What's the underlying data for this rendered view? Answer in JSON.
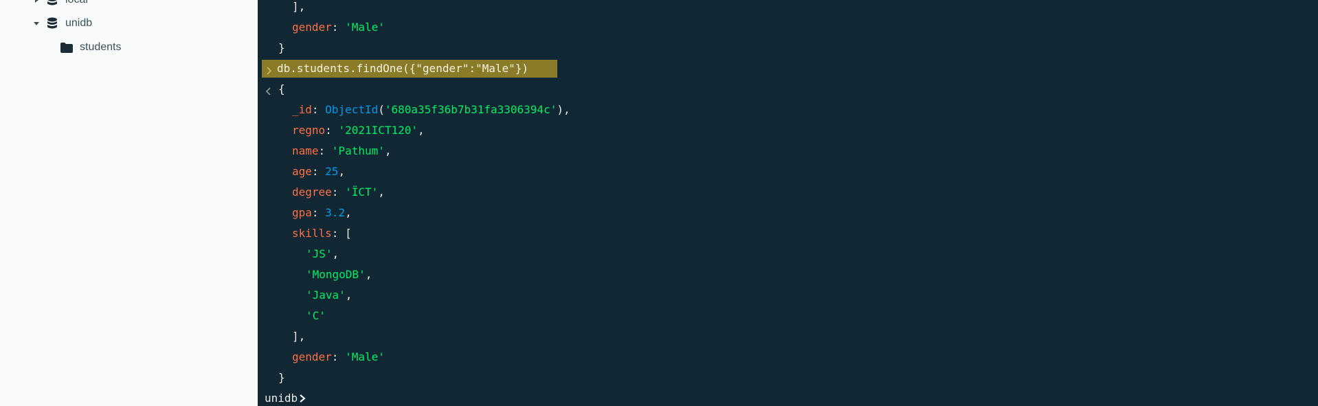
{
  "sidebar": {
    "databases": [
      {
        "label": "local",
        "expanded": false,
        "icon": "database-icon"
      },
      {
        "label": "unidb",
        "expanded": true,
        "icon": "database-icon"
      }
    ],
    "collections": [
      {
        "label": "students",
        "icon": "folder-icon"
      }
    ]
  },
  "shell": {
    "prev_result_tail": {
      "close_bracket": "],",
      "gender_key": "gender",
      "gender_value": "'Male'",
      "close_brace": "}"
    },
    "command": "db.students.findOne({\"gender\":\"Male\"})",
    "result": {
      "open_brace": "{",
      "id_key": "_id",
      "id_fn": "ObjectId",
      "id_value": "'680a35f36b7b31fa3306394c'",
      "regno_key": "regno",
      "regno_value": "'2021ICT120'",
      "name_key": "name",
      "name_value": "'Pathum'",
      "age_key": "age",
      "age_value": "25",
      "degree_key": "degree",
      "degree_value": "'ÏCT'",
      "gpa_key": "gpa",
      "gpa_value": "3.2",
      "skills_key": "skills",
      "skills": [
        "'JS'",
        "'MongoDB'",
        "'Java'",
        "'C'"
      ],
      "close_bracket": "],",
      "gender_key": "gender",
      "gender_value": "'Male'",
      "close_brace": "}"
    },
    "prompt": "unidb"
  },
  "colors": {
    "shell_bg": "#112733",
    "key": "#ff6f44",
    "string": "#00ed64",
    "number": "#0498ec",
    "highlight": "#8a7b29",
    "sidebar_bg": "#f9fbfa"
  }
}
